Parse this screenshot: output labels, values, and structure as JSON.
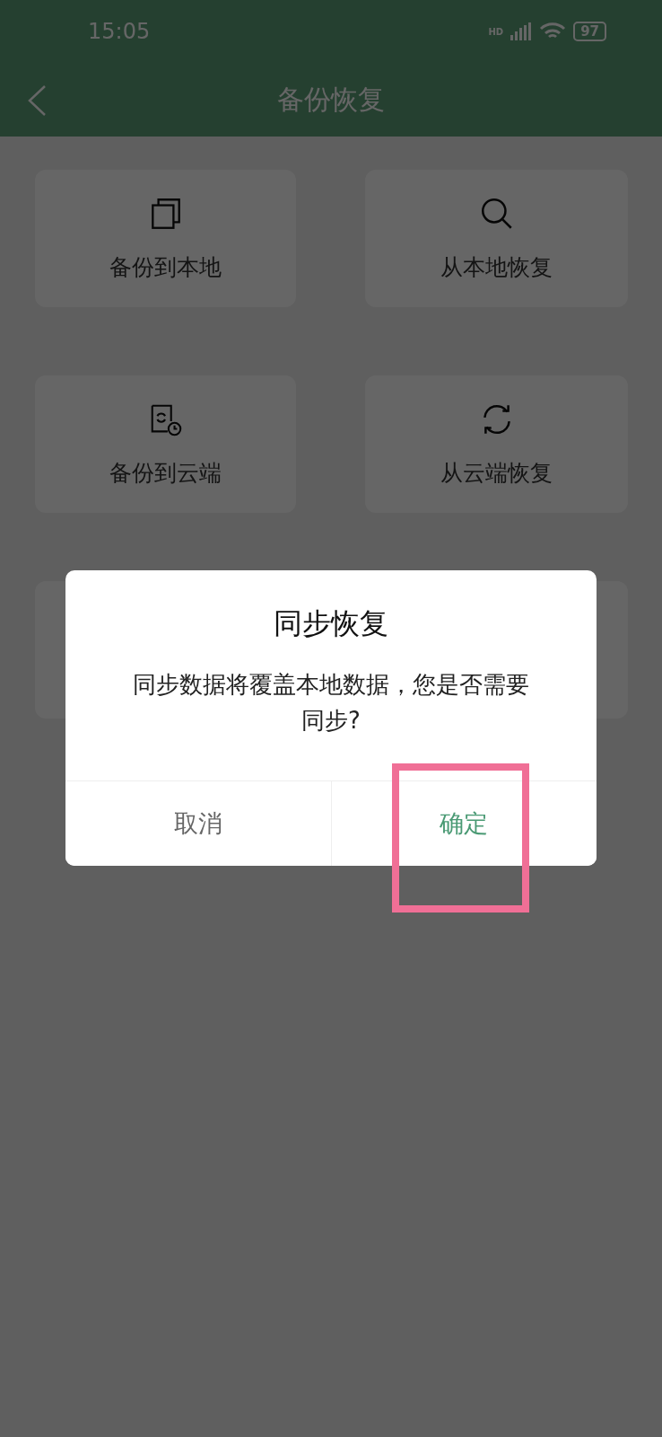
{
  "status_bar": {
    "time": "15:05",
    "network": "HD",
    "battery": "97"
  },
  "header": {
    "title": "备份恢复"
  },
  "cards": [
    {
      "label": "备份到本地",
      "kind": "copy"
    },
    {
      "label": "从本地恢复",
      "kind": "search"
    },
    {
      "label": "备份到云端",
      "kind": "cloud"
    },
    {
      "label": "从云端恢复",
      "kind": "sync"
    }
  ],
  "dialog": {
    "title": "同步恢复",
    "message": "同步数据将覆盖本地数据，您是否需要同步?",
    "buttons": [
      {
        "label": "取消",
        "kind": "cancel"
      },
      {
        "label": "确定",
        "kind": "confirm"
      }
    ]
  }
}
